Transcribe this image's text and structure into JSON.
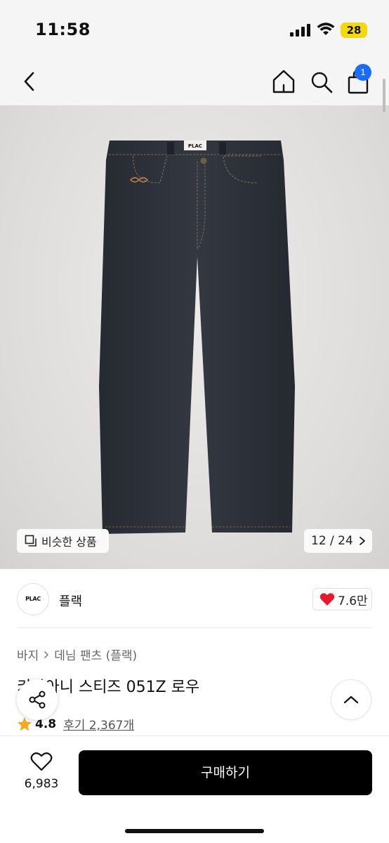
{
  "status_bar": {
    "time": "11:58",
    "battery": "28"
  },
  "nav": {
    "cart_badge": "1"
  },
  "gallery": {
    "similar_label": "비슷한 상품",
    "counter": "12 / 24",
    "label_tag": "PLAC"
  },
  "brand": {
    "logo_text": "PLAC",
    "name": "플랙",
    "likes": "7.6만"
  },
  "product": {
    "breadcrumb": [
      "바지",
      "데님 팬츠 (플랙)"
    ],
    "title": "키라아니 스티즈 051Z 로우",
    "rating": "4.8",
    "reviews": "후기 2,367개"
  },
  "bottom": {
    "wish_count": "6,983",
    "buy_label": "구매하기"
  },
  "colors": {
    "accent_blue": "#1a6bff",
    "heart_red": "#e8192c",
    "star_orange": "#f5a623",
    "buy_bg": "#000000"
  }
}
